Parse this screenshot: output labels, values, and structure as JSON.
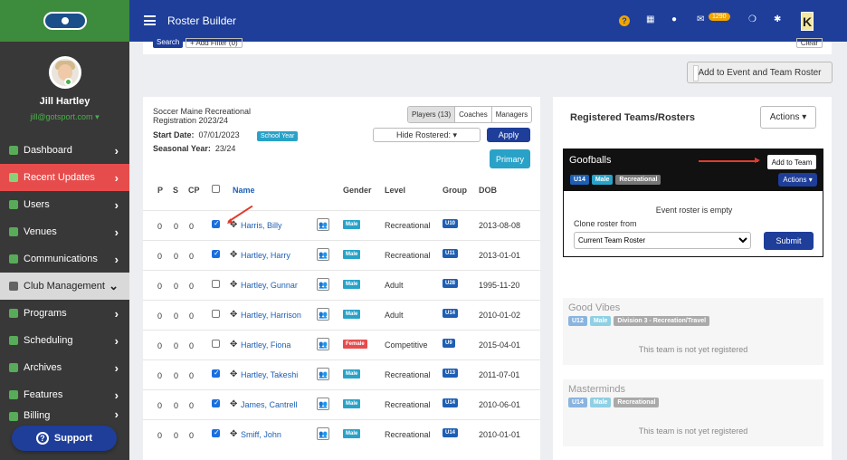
{
  "sidebar": {
    "user_name": "Jill Hartley",
    "user_email": "jill@gotsport.com",
    "items": [
      {
        "label": "Dashboard",
        "icon": "dashboard-icon"
      },
      {
        "label": "Recent Updates",
        "icon": "refresh-icon"
      },
      {
        "label": "Users",
        "icon": "users-icon"
      },
      {
        "label": "Venues",
        "icon": "map-marker-icon"
      },
      {
        "label": "Communications",
        "icon": "comment-icon"
      },
      {
        "label": "Club Management",
        "icon": "list-icon"
      },
      {
        "label": "Programs",
        "icon": "programs-icon"
      },
      {
        "label": "Scheduling",
        "icon": "calendar-icon"
      },
      {
        "label": "Archives",
        "icon": "archive-icon"
      },
      {
        "label": "Features",
        "icon": "star-icon"
      },
      {
        "label": "Billing",
        "icon": "billing-icon"
      }
    ],
    "support_label": "Support"
  },
  "topbar": {
    "title": "Roster Builder",
    "badge_count": "1290"
  },
  "strip": {
    "search_label": "Search",
    "filter_label": "+ Add Filter (0)",
    "clear_label": "Clear"
  },
  "add_event_label": "Add to Event and Team Roster",
  "left": {
    "program_name": "Soccer Maine Recreational Registration 2023/24",
    "tabs": [
      "Players (13)",
      "Coaches",
      "Managers"
    ],
    "start_date_label": "Start Date:",
    "start_date": "07/01/2023",
    "school_year_tag": "School Year",
    "seasonal_label": "Seasonal Year:",
    "seasonal_year": "23/24",
    "hide_rostered": "Hide Rostered: ▾",
    "apply_label": "Apply",
    "primary_label": "Primary",
    "columns": {
      "p": "P",
      "s": "S",
      "cp": "CP",
      "name": "Name",
      "gender": "Gender",
      "level": "Level",
      "group": "Group",
      "dob": "DOB"
    },
    "players": [
      {
        "p": "0",
        "s": "0",
        "cp": "0",
        "checked": true,
        "name": "Harris, Billy",
        "gender": "Male",
        "level": "Recreational",
        "group": "U10",
        "dob": "2013-08-08"
      },
      {
        "p": "0",
        "s": "0",
        "cp": "0",
        "checked": true,
        "name": "Hartley, Harry",
        "gender": "Male",
        "level": "Recreational",
        "group": "U11",
        "dob": "2013-01-01"
      },
      {
        "p": "0",
        "s": "0",
        "cp": "0",
        "checked": false,
        "name": "Hartley, Gunnar",
        "gender": "Male",
        "level": "Adult",
        "group": "U28",
        "dob": "1995-11-20"
      },
      {
        "p": "0",
        "s": "0",
        "cp": "0",
        "checked": false,
        "name": "Hartley, Harrison",
        "gender": "Male",
        "level": "Adult",
        "group": "U14",
        "dob": "2010-01-02"
      },
      {
        "p": "0",
        "s": "0",
        "cp": "0",
        "checked": false,
        "name": "Hartley, Fiona",
        "gender": "Female",
        "level": "Competitive",
        "group": "U9",
        "dob": "2015-04-01"
      },
      {
        "p": "0",
        "s": "0",
        "cp": "0",
        "checked": true,
        "name": "Hartley, Takeshi",
        "gender": "Male",
        "level": "Recreational",
        "group": "U13",
        "dob": "2011-07-01"
      },
      {
        "p": "0",
        "s": "0",
        "cp": "0",
        "checked": true,
        "name": "James, Cantrell",
        "gender": "Male",
        "level": "Recreational",
        "group": "U14",
        "dob": "2010-06-01"
      },
      {
        "p": "0",
        "s": "0",
        "cp": "0",
        "checked": true,
        "name": "Smiff, John",
        "gender": "Male",
        "level": "Recreational",
        "group": "U14",
        "dob": "2010-01-01"
      }
    ]
  },
  "right": {
    "title": "Registered Teams/Rosters",
    "actions_label": "Actions ▾",
    "goofballs": {
      "name": "Goofballs",
      "add_label": "Add to Team",
      "tags": [
        "U14",
        "Male",
        "Recreational"
      ],
      "actions_label": "Actions ▾",
      "empty_msg": "Event roster is empty",
      "clone_label": "Clone roster from",
      "clone_value": "Current Team Roster",
      "submit_label": "Submit"
    },
    "teams": [
      {
        "name": "Good Vibes",
        "tags": [
          "U12",
          "Male",
          "Division 3 - Recreation/Travel"
        ],
        "status": "This team is not yet registered"
      },
      {
        "name": "Masterminds",
        "tags": [
          "U14",
          "Male",
          "Recreational"
        ],
        "status": "This team is not yet registered"
      }
    ]
  },
  "colors": {
    "brand": "#1e3e9a",
    "active_nav": "#e74c4c",
    "male": "#2aa2c8",
    "female": "#e74c4c",
    "annotation": "#e03b2d"
  }
}
